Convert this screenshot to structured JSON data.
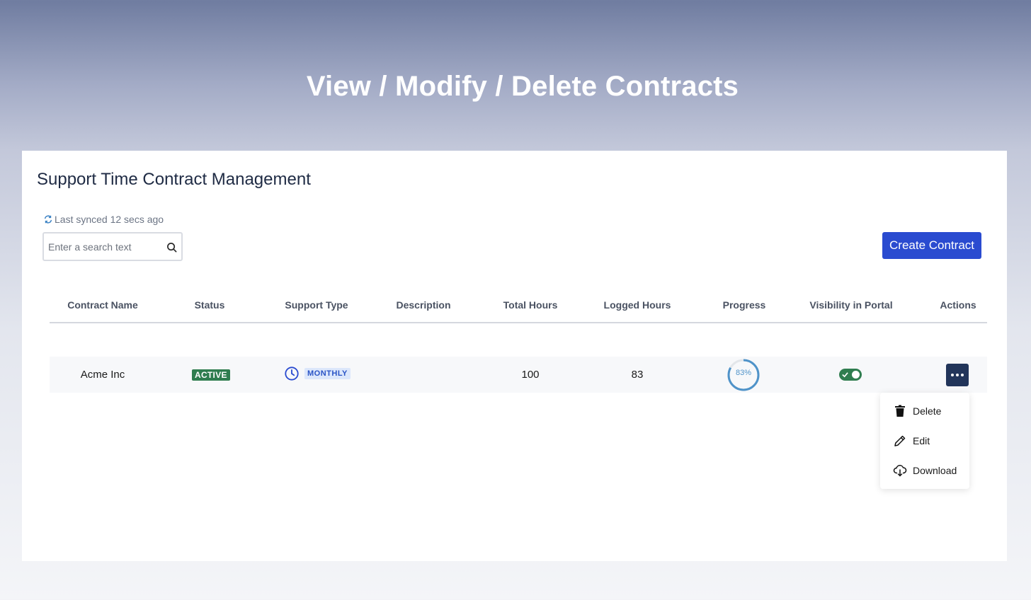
{
  "hero": {
    "title": "View / Modify / Delete Contracts"
  },
  "panel": {
    "title": "Support Time Contract Management",
    "sync_text": "Last synced 12 secs ago",
    "sync_icon": "refresh-icon",
    "search_placeholder": "Enter a search text",
    "search_icon": "search-icon",
    "create_button": "Create Contract"
  },
  "table": {
    "headers": [
      "Contract Name",
      "Status",
      "Support Type",
      "Description",
      "Total Hours",
      "Logged Hours",
      "Progress",
      "Visibility in Portal",
      "Actions"
    ],
    "rows": [
      {
        "contract_name": "Acme Inc",
        "status": "ACTIVE",
        "support_type": "MONTHLY",
        "support_type_icon": "clock-icon",
        "description": "",
        "total_hours": "100",
        "logged_hours": "83",
        "progress": 0.83,
        "progress_label": "83%",
        "visible_in_portal": true
      }
    ]
  },
  "actions_menu": {
    "items": [
      {
        "label": "Delete",
        "icon": "trash-icon"
      },
      {
        "label": "Edit",
        "icon": "pencil-icon"
      },
      {
        "label": "Download",
        "icon": "cloud-download-icon"
      }
    ]
  },
  "colors": {
    "primary": "#2a4bd0",
    "active_badge": "#2f7d4f",
    "monthly_badge_bg": "#dce7fb",
    "monthly_badge_text": "#2a54c6",
    "progress": "#4f93c9",
    "actions_button": "#22355a"
  }
}
